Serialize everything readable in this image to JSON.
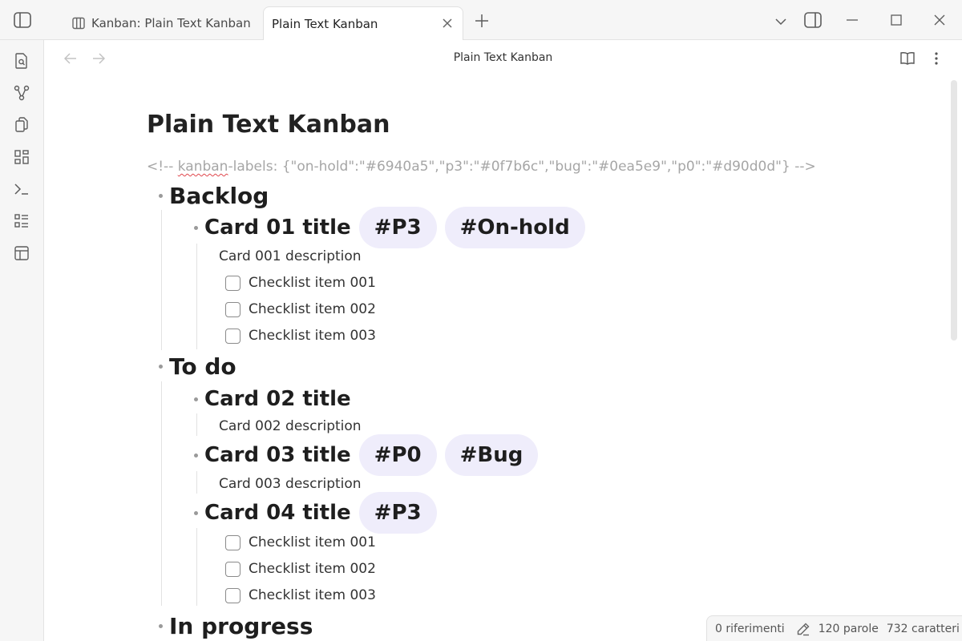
{
  "window": {
    "tabs": [
      {
        "label": "Kanban: Plain Text Kanban",
        "icon": "kanban-board-icon",
        "active": false
      },
      {
        "label": "Plain Text Kanban",
        "active": true
      }
    ]
  },
  "view": {
    "title": "Plain Text Kanban"
  },
  "document": {
    "title": "Plain Text Kanban",
    "comment_prefix": "<!-- ",
    "comment_word": "kanban",
    "comment_rest": "-labels: {\"on-hold\":\"#6940a5\",\"p3\":\"#0f7b6c\",\"bug\":\"#0ea5e9\",\"p0\":\"#d90d0d\"} -->",
    "columns": [
      {
        "name": "Backlog",
        "cards": [
          {
            "title": "Card 01 title",
            "tags": [
              "#P3",
              "#On-hold"
            ],
            "description": "Card 001 description",
            "checklist": [
              "Checklist item 001",
              "Checklist item 002",
              "Checklist item 003"
            ]
          }
        ]
      },
      {
        "name": "To do",
        "cards": [
          {
            "title": "Card 02 title",
            "tags": [],
            "description": "Card 002 description"
          },
          {
            "title": "Card 03 title",
            "tags": [
              "#P0",
              "#Bug"
            ],
            "description": "Card 003 description"
          },
          {
            "title": "Card 04 title",
            "tags": [
              "#P3"
            ],
            "checklist": [
              "Checklist item 001",
              "Checklist item 002",
              "Checklist item 003"
            ]
          }
        ]
      },
      {
        "name": "In progress",
        "cards": []
      }
    ]
  },
  "statusbar": {
    "references": "0 riferimenti",
    "words": "120 parole",
    "characters": "732 caratteri"
  },
  "colors": {
    "tag_background": "#efedfb",
    "comment_text": "#a6a6a6",
    "chrome_background": "#f6f6f6"
  }
}
